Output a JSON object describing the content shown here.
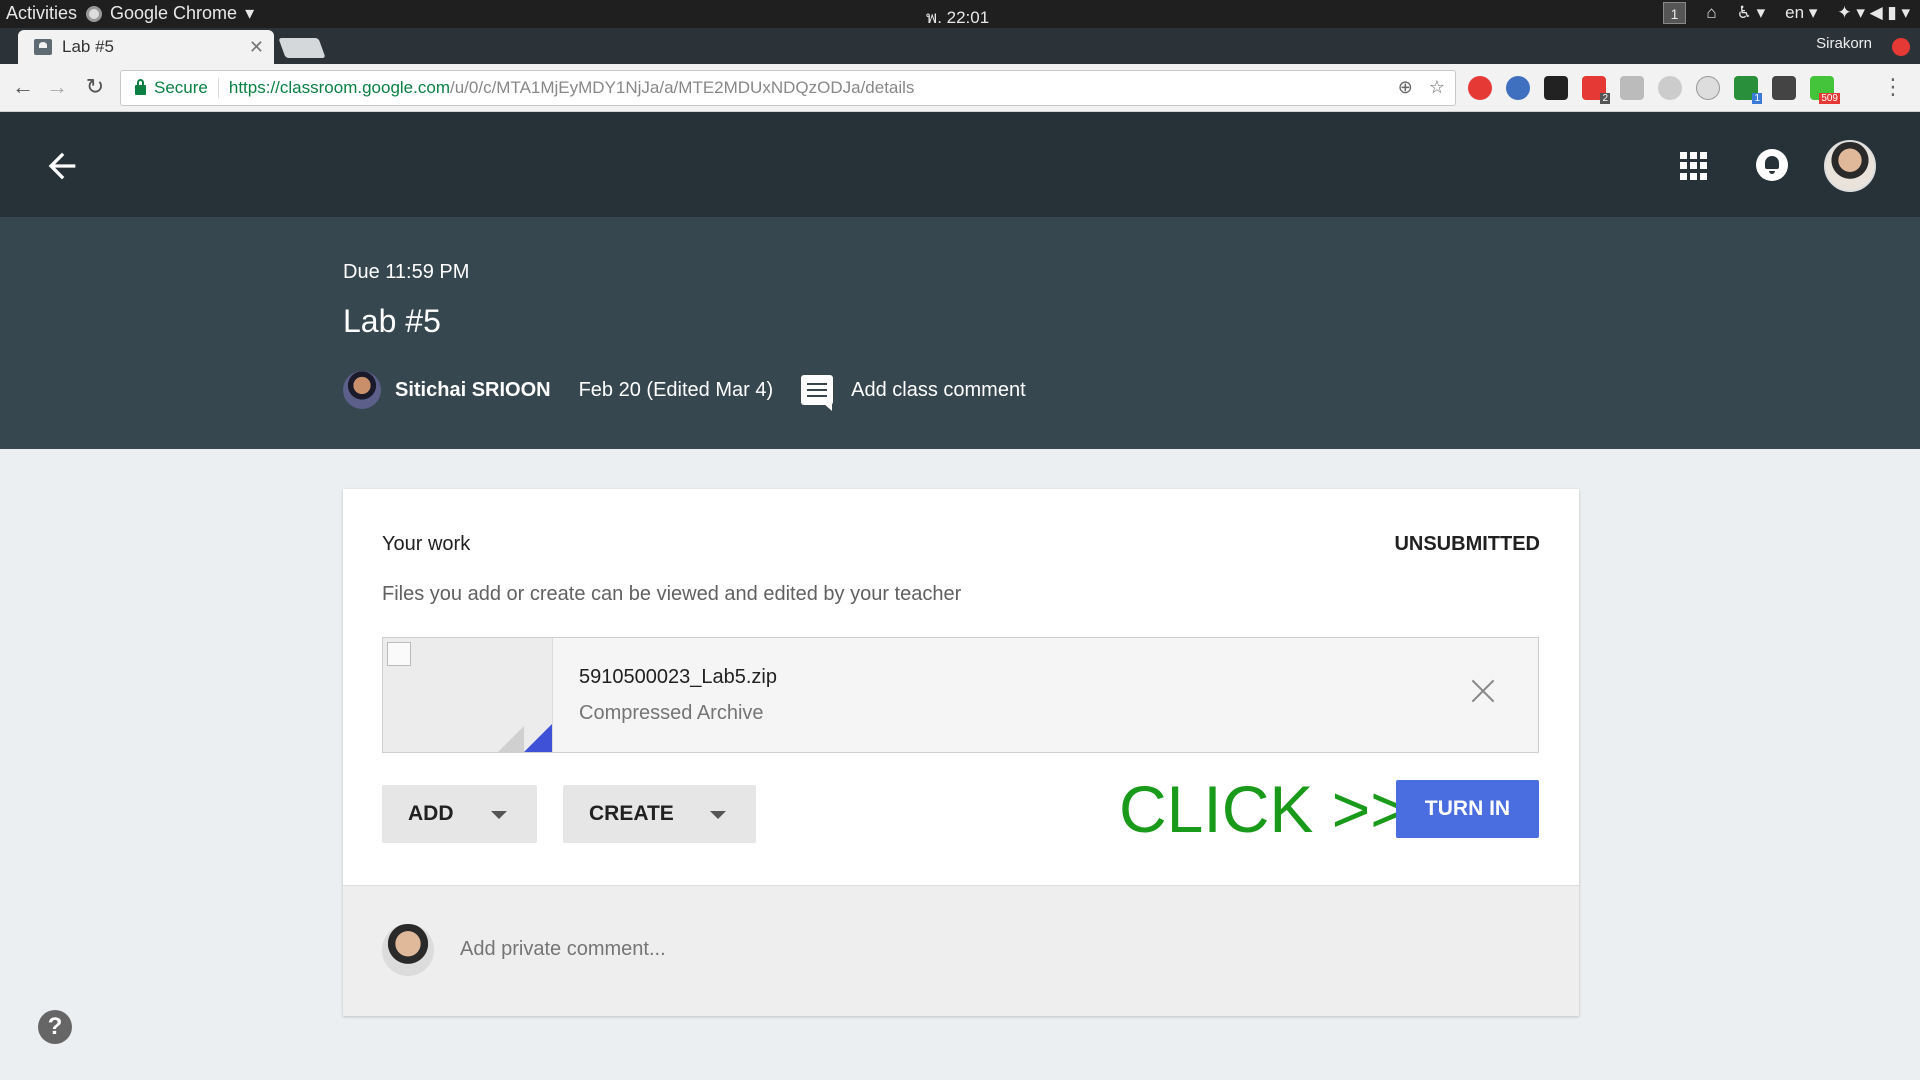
{
  "gnome": {
    "activities": "Activities",
    "app_name": "Google Chrome",
    "clock": "พ. 22:01",
    "workspace": "1",
    "lang": "en"
  },
  "browser": {
    "tab_title": "Lab #5",
    "profile_name": "Sirakorn",
    "secure_label": "Secure",
    "url_host": "https://classroom.google.com",
    "url_path": "/u/0/c/MTA1MjEyMDY1NjJa/a/MTE2MDUxNDQzODJa/details",
    "extension_badges": [
      "2",
      "1",
      "509"
    ]
  },
  "assignment": {
    "due": "Due 11:59 PM",
    "title": "Lab #5",
    "author": "Sitichai SRIOON",
    "date": "Feb 20 (Edited Mar 4)",
    "class_comment": "Add class comment"
  },
  "work": {
    "heading": "Your work",
    "status": "UNSUBMITTED",
    "note": "Files you add or create can be viewed and edited by your teacher",
    "file": {
      "name": "5910500023_Lab5.zip",
      "type": "Compressed Archive"
    },
    "add_label": "ADD",
    "create_label": "CREATE",
    "annotation": "CLICK >>",
    "turn_in_label": "TURN IN",
    "private_comment_placeholder": "Add private comment..."
  },
  "help": "?",
  "colors": {
    "appbar": "#263238",
    "header": "#37474f",
    "turn_in": "#4a6ee0",
    "annotation": "#1a9a1a"
  }
}
